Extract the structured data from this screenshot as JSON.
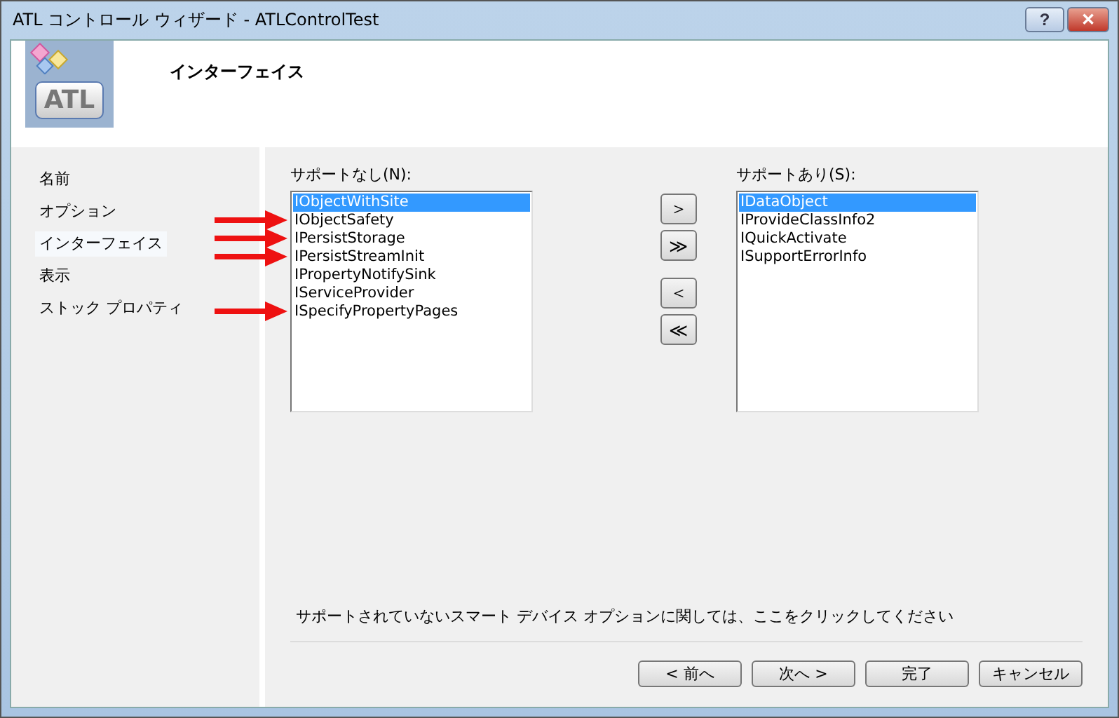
{
  "window": {
    "title": "ATL コントロール ウィザード - ATLControlTest",
    "help": "?",
    "close": "✕"
  },
  "header": {
    "logo": "ATL",
    "title": "インターフェイス"
  },
  "sidebar": {
    "items": [
      {
        "label": "名前",
        "selected": false
      },
      {
        "label": "オプション",
        "selected": false
      },
      {
        "label": "インターフェイス",
        "selected": true
      },
      {
        "label": "表示",
        "selected": false
      },
      {
        "label": "ストック プロパティ",
        "selected": false
      }
    ]
  },
  "unsupported": {
    "label": "サポートなし(N):",
    "items": [
      {
        "label": "IObjectWithSite",
        "selected": true,
        "marked": false
      },
      {
        "label": "IObjectSafety",
        "selected": false,
        "marked": true
      },
      {
        "label": "IPersistStorage",
        "selected": false,
        "marked": true
      },
      {
        "label": "IPersistStreamInit",
        "selected": false,
        "marked": true
      },
      {
        "label": "IPropertyNotifySink",
        "selected": false,
        "marked": false
      },
      {
        "label": "IServiceProvider",
        "selected": false,
        "marked": false
      },
      {
        "label": "ISpecifyPropertyPages",
        "selected": false,
        "marked": true
      }
    ]
  },
  "add_buttons": [
    "＞",
    "≫"
  ],
  "remove_buttons": [
    "＜",
    "≪"
  ],
  "supported": {
    "label": "サポートあり(S):",
    "items": [
      {
        "label": "IDataObject",
        "selected": true
      },
      {
        "label": "IProvideClassInfo2",
        "selected": false
      },
      {
        "label": "IQuickActivate",
        "selected": false
      },
      {
        "label": "ISupportErrorInfo",
        "selected": false
      }
    ]
  },
  "note": "サポートされていないスマート デバイス オプションに関しては、ここをクリックしてください",
  "buttons": [
    "< 前へ",
    "次へ >",
    "完了",
    "キャンセル"
  ]
}
